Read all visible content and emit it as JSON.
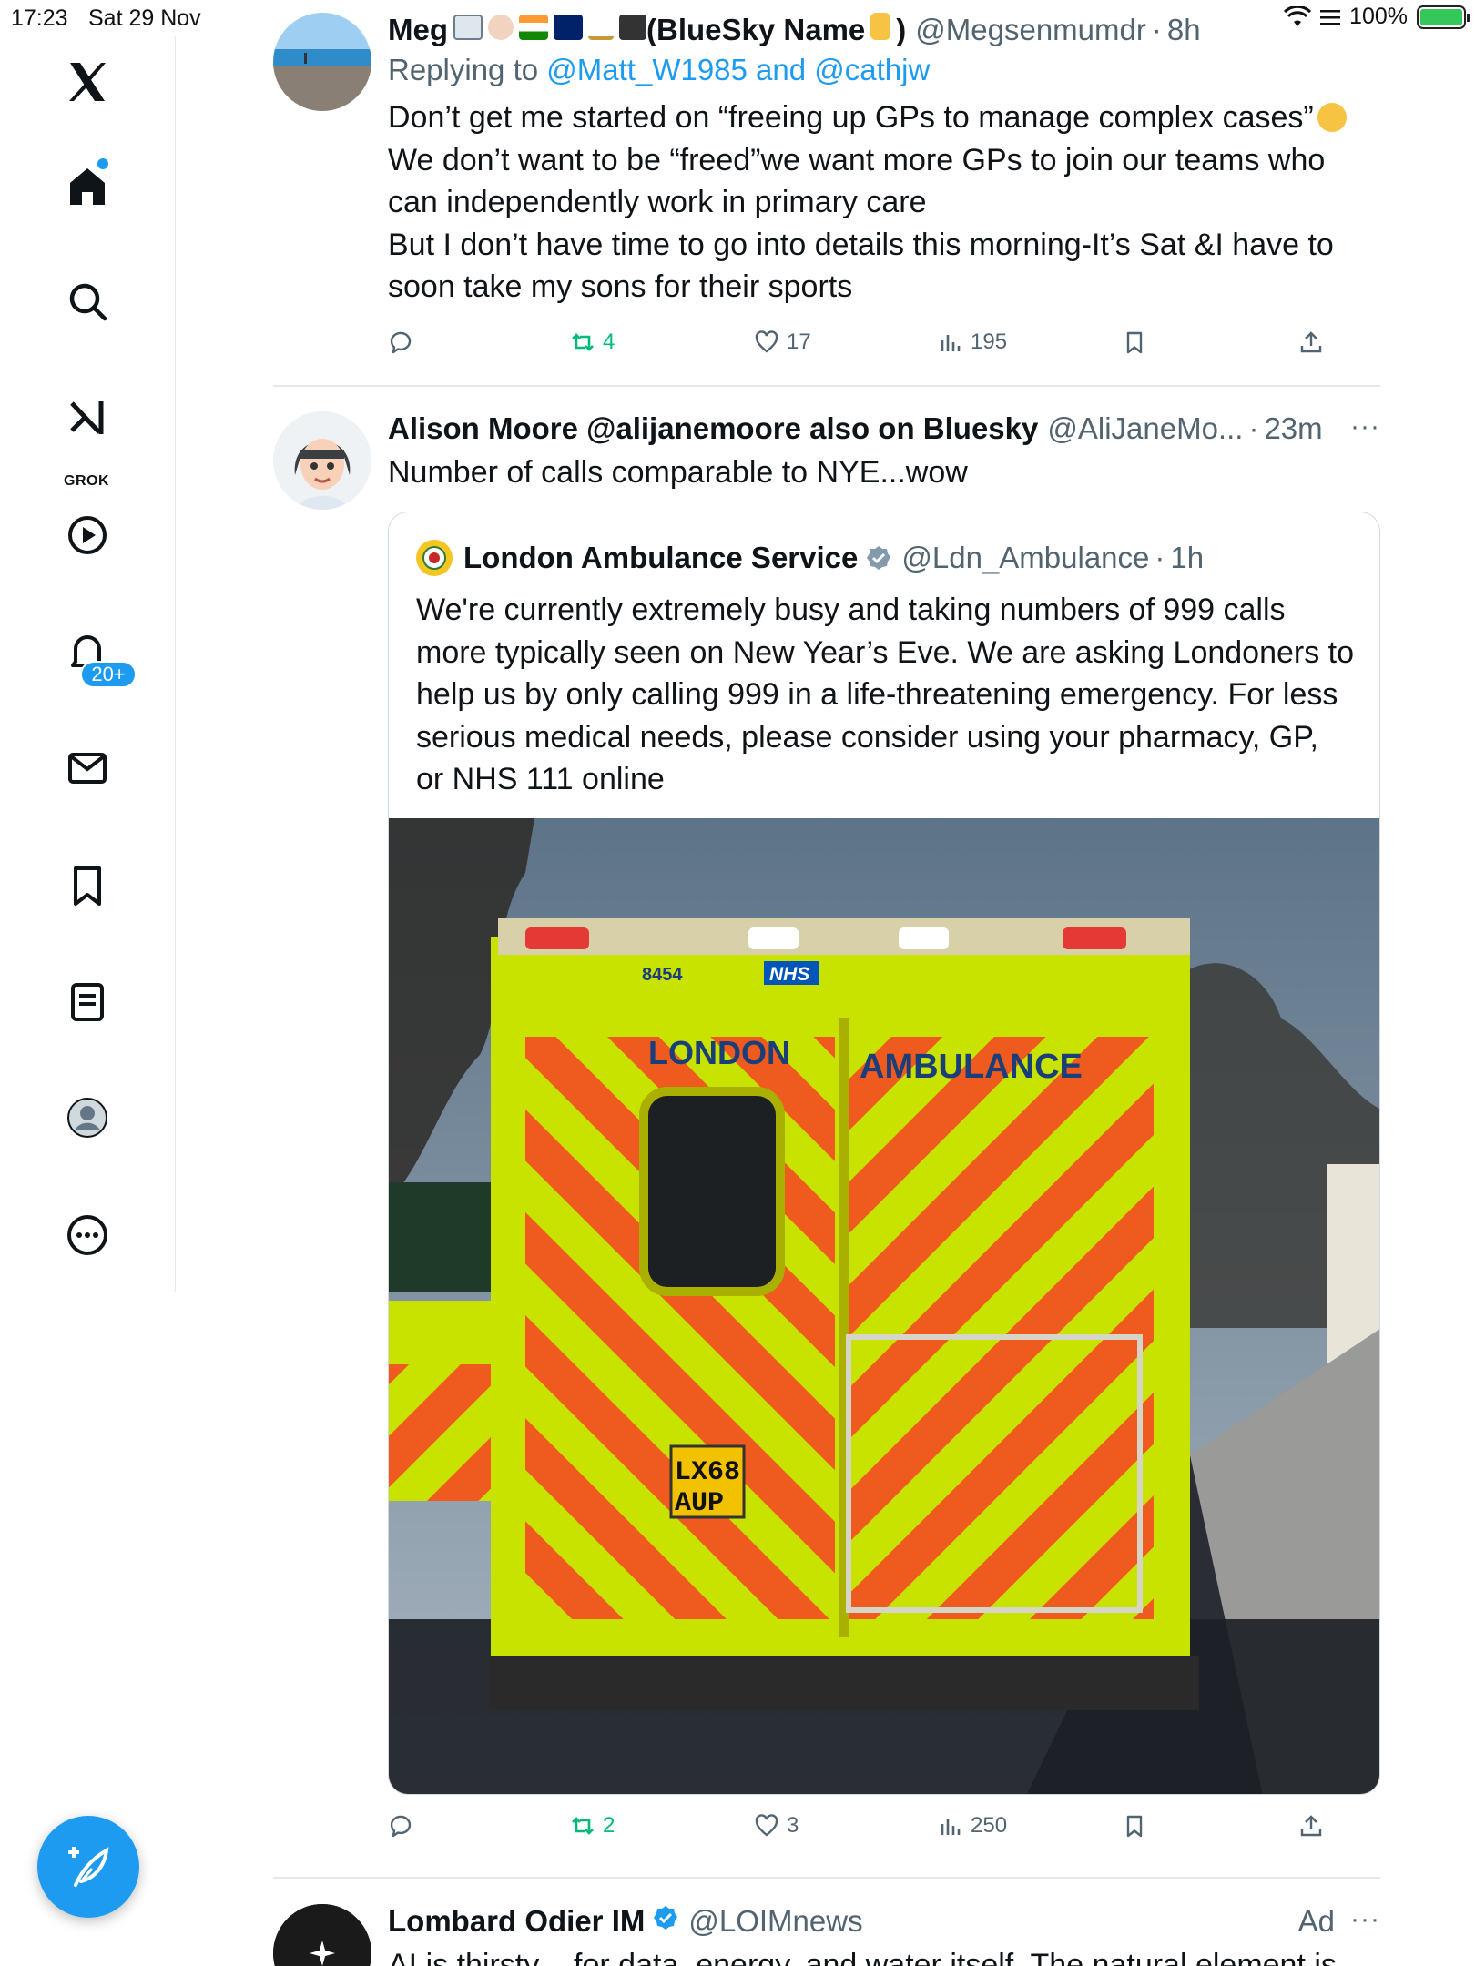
{
  "status_bar": {
    "time": "17:23",
    "date": "Sat 29 Nov",
    "battery": "100%"
  },
  "sidebar": {
    "notifications_badge": "20+",
    "grok_label": "GROK",
    "icons": [
      "x-logo-icon",
      "home-icon",
      "search-icon",
      "grok-icon",
      "video-icon",
      "bell-icon",
      "mail-icon",
      "bookmark-icon",
      "lists-icon",
      "profile-icon",
      "more-icon"
    ]
  },
  "tweets": [
    {
      "name": "Meg",
      "name_suffix": "(BlueSky Name",
      "name_close": ")",
      "handle": "@Megsenmumdr",
      "time": "8h",
      "reply_prefix": "Replying to",
      "reply_to": "@Matt_W1985 and @cathjw",
      "lines": [
        "Don’t get me started on “freeing up GPs to manage complex cases”",
        "We don’t want to be “freed”we want more GPs to join our teams who",
        "can independently work in primary care",
        "But I don’t have time to go into details this morning-It’s Sat &I have to",
        "soon take my sons for their sports"
      ],
      "retweets": "4",
      "likes": "17",
      "views": "195"
    },
    {
      "name": "Alison Moore @alijanemoore also on Bluesky",
      "handle": "@AliJaneMo...",
      "time": "23m",
      "lines": [
        "Number of calls comparable to NYE...wow"
      ],
      "quote": {
        "name": "London Ambulance Service",
        "handle": "@Ldn_Ambulance",
        "time": "1h",
        "lines": [
          "We're currently extremely busy and taking numbers of 999 calls",
          "more typically seen on New Year’s Eve. We are asking Londoners to",
          "help us by only calling 999 in a life-threatening emergency. For less",
          "serious medical needs, please consider using your pharmacy, GP,",
          "or NHS 111 online"
        ],
        "image": {
          "fleet_number": "8454",
          "nhs": "NHS",
          "london": "LONDON",
          "ambulance": "AMBULANCE",
          "plate_1": "LX68",
          "plate_2": "AUP"
        }
      },
      "retweets": "2",
      "likes": "3",
      "views": "250"
    },
    {
      "name": "Lombard Odier IM",
      "handle": "@LOIMnews",
      "ad": "Ad",
      "lines": [
        "AI is thirsty – for data, energy, and water itself. The natural element is"
      ]
    }
  ],
  "colors": {
    "accent": "#1d9bf0",
    "retweet": "#00ba7c",
    "muted": "#536471"
  }
}
